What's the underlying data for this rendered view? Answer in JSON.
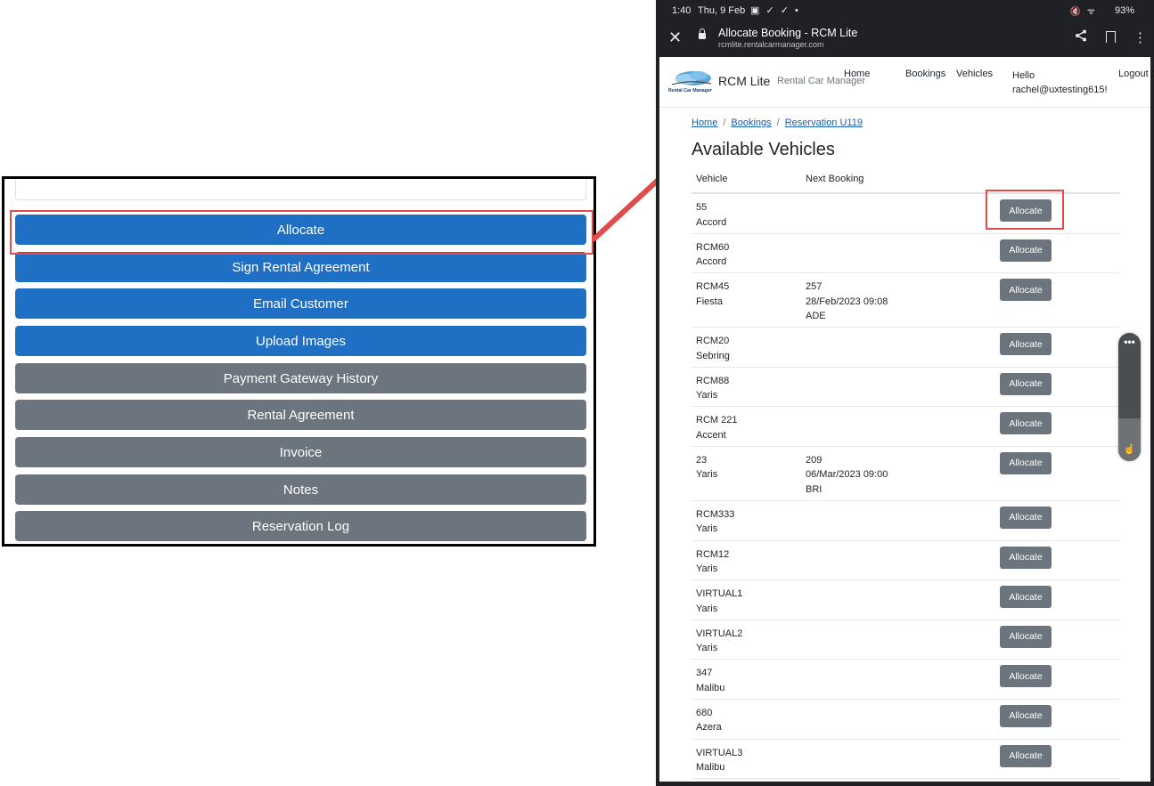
{
  "left_panel": {
    "buttons": [
      {
        "label": "Allocate",
        "variant": "blue"
      },
      {
        "label": "Sign Rental Agreement",
        "variant": "blue"
      },
      {
        "label": "Email Customer",
        "variant": "blue"
      },
      {
        "label": "Upload Images",
        "variant": "blue"
      },
      {
        "label": "Payment Gateway History",
        "variant": "grey"
      },
      {
        "label": "Rental Agreement",
        "variant": "grey"
      },
      {
        "label": "Invoice",
        "variant": "grey"
      },
      {
        "label": "Notes",
        "variant": "grey"
      },
      {
        "label": "Reservation Log",
        "variant": "grey"
      }
    ]
  },
  "status_bar": {
    "time": "1:40",
    "date": "Thu, 9 Feb",
    "notification_icons": "▣ ✓ ✓ •",
    "system_icons": "🔇 ᯤ",
    "battery": "93%"
  },
  "browser": {
    "page_title": "Allocate Booking - RCM Lite",
    "url": "rcmlite.rentalcarmanager.com"
  },
  "site": {
    "logo_text": "Rental Car Manager",
    "brand": "RCM Lite",
    "tagline": "Rental Car Manager",
    "nav": {
      "home": "Home",
      "bookings": "Bookings",
      "vehicles": "Vehicles",
      "logout": "Logout"
    },
    "hello_line1": "Hello",
    "hello_line2": "rachel@uxtesting615!"
  },
  "breadcrumb": {
    "home": "Home",
    "bookings": "Bookings",
    "current": "Reservation U119"
  },
  "page_title": "Available Vehicles",
  "table": {
    "headers": {
      "vehicle": "Vehicle",
      "next_booking": "Next Booking"
    },
    "button_label": "Allocate",
    "rows": [
      {
        "vehicle": "55",
        "model": "Accord",
        "next": []
      },
      {
        "vehicle": "RCM60",
        "model": "Accord",
        "next": []
      },
      {
        "vehicle": "RCM45",
        "model": "Fiesta",
        "next": [
          "257",
          "28/Feb/2023 09:08",
          "ADE"
        ]
      },
      {
        "vehicle": "RCM20",
        "model": "Sebring",
        "next": []
      },
      {
        "vehicle": "RCM88",
        "model": "Yaris",
        "next": []
      },
      {
        "vehicle": "RCM 221",
        "model": "Accent",
        "next": []
      },
      {
        "vehicle": "23",
        "model": "Yaris",
        "next": [
          "209",
          "06/Mar/2023 09:00",
          "BRI"
        ]
      },
      {
        "vehicle": "RCM333",
        "model": "Yaris",
        "next": []
      },
      {
        "vehicle": "RCM12",
        "model": "Yaris",
        "next": []
      },
      {
        "vehicle": "VIRTUAL1",
        "model": "Yaris",
        "next": []
      },
      {
        "vehicle": "VIRTUAL2",
        "model": "Yaris",
        "next": []
      },
      {
        "vehicle": "347",
        "model": "Malibu",
        "next": []
      },
      {
        "vehicle": "680",
        "model": "Azera",
        "next": []
      },
      {
        "vehicle": "VIRTUAL3",
        "model": "Malibu",
        "next": []
      }
    ]
  },
  "colors": {
    "primary": "#1f6fc4",
    "secondary": "#6c757d",
    "highlight": "#e04c4c",
    "link": "#1a5fb4"
  }
}
